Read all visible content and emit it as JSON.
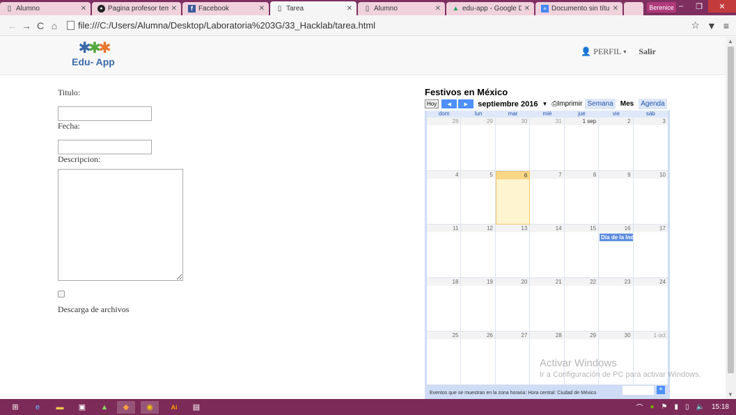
{
  "browser": {
    "tabs": [
      {
        "label": "Alumno",
        "icon": "page-icon",
        "active": false
      },
      {
        "label": "Pagina profesor tem",
        "icon": "github-icon",
        "active": false
      },
      {
        "label": "Facebook",
        "icon": "facebook-icon",
        "active": false
      },
      {
        "label": "Tarea",
        "icon": "page-icon",
        "active": true
      },
      {
        "label": "Alumno",
        "icon": "page-icon",
        "active": false
      },
      {
        "label": "edu-app - Google D",
        "icon": "drive-icon",
        "active": false
      },
      {
        "label": "Documento sin títul",
        "icon": "docs-icon",
        "active": false
      }
    ],
    "profile_name": "Berenice",
    "url": "file:///C:/Users/Alumna/Desktop/Laboratoria%203G/33_Hacklab/tarea.html"
  },
  "site": {
    "logo_text": "Edu- App",
    "nav": {
      "perfil": "PERFIL",
      "salir": "Salir"
    }
  },
  "form": {
    "titulo_label": "Titulo:",
    "titulo_value": "",
    "fecha_label": "Fecha:",
    "fecha_value": "",
    "descripcion_label": "Descripcion:",
    "descarga_label": "Descarga de archivos"
  },
  "calendar": {
    "title": "Festivos en México",
    "hoy": "Hoy",
    "month_label": "septiembre 2016",
    "imprimir": "Imprimir",
    "views": {
      "semana": "Semana",
      "mes": "Mes",
      "agenda": "Agenda"
    },
    "weekdays": [
      "dom",
      "lun",
      "mar",
      "mié",
      "jue",
      "vie",
      "sáb"
    ],
    "days": [
      "28",
      "29",
      "30",
      "31",
      "1 sep",
      "2",
      "3",
      "4",
      "5",
      "6",
      "7",
      "8",
      "9",
      "10",
      "11",
      "12",
      "13",
      "14",
      "15",
      "16",
      "17",
      "18",
      "19",
      "20",
      "21",
      "22",
      "23",
      "24",
      "25",
      "26",
      "27",
      "28",
      "29",
      "30",
      "1 oct"
    ],
    "event": {
      "day_index": 19,
      "label": "Día de la Independencia"
    },
    "footer": "Eventos que se muestran en la zona horaria: Hora central: Ciudad de México"
  },
  "watermark": {
    "line1": "Activar Windows",
    "line2": "Ir a Configuración de PC para activar Windows."
  },
  "taskbar": {
    "clock": "15:18"
  }
}
